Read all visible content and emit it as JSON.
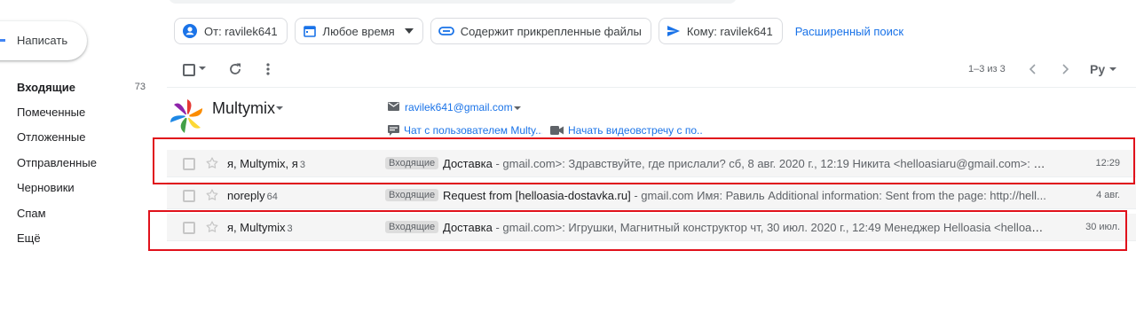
{
  "sidebar": {
    "compose_label": "Написать",
    "items": [
      {
        "label": "Входящие",
        "count": "73",
        "active": true
      },
      {
        "label": "Помеченные"
      },
      {
        "label": "Отложенные"
      },
      {
        "label": "Отправленные"
      },
      {
        "label": "Черновики"
      },
      {
        "label": "Спам"
      },
      {
        "label": "Ещё"
      }
    ]
  },
  "filters": {
    "from": "От: ravilek641",
    "time": "Любое время",
    "attachments": "Содержит прикрепленные файлы",
    "to": "Кому: ravilek641",
    "advanced": "Расширенный поиск"
  },
  "toolbar": {
    "pagination": "1–3 из 3",
    "lang": "Ру"
  },
  "contact": {
    "name": "Multymix",
    "email": "ravilek641@gmail.com",
    "chat": "Чат с пользователем Multy...",
    "video": "Начать видеовстречу с по..."
  },
  "emails": [
    {
      "sender": "я, Multymix, я",
      "count": "3",
      "label": "Входящие",
      "subject": "Доставка",
      "snippet": " - gmail.com>: Здравствуйте, где прислали? сб, 8 авг. 2020 г., 12:19 Никита <helloasiaru@gmail.com>: Д...",
      "date": "12:29"
    },
    {
      "sender": "noreply",
      "count": "64",
      "label": "Входящие",
      "subject": "Request from [helloasia-dostavka.ru]",
      "snippet": " - gmail.com Имя: Равиль Additional information: Sent from the page: http://hell...",
      "date": "4 авг."
    },
    {
      "sender": "я, Multymix",
      "count": "3",
      "label": "Входящие",
      "subject": "Доставка",
      "snippet": " - gmail.com>: Игрушки, Магнитный конструктор чт, 30 июл. 2020 г., 12:49 Менеджер Helloasia <helloas...",
      "date": "30 июл."
    }
  ],
  "colors": {
    "accent": "#1a73e8",
    "highlight": "#e0111b",
    "label_bg": "#dddddd"
  }
}
